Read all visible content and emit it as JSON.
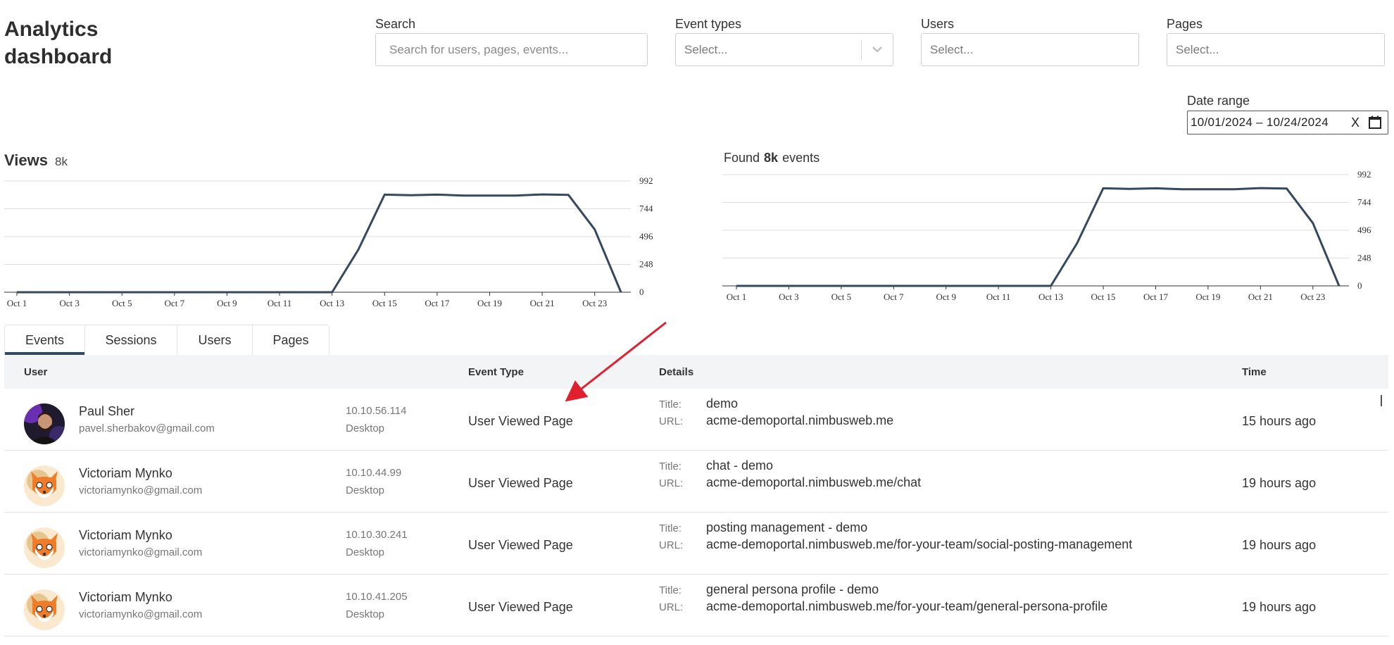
{
  "page": {
    "title_line1": "Analytics",
    "title_line2": "dashboard"
  },
  "filters": {
    "search": {
      "label": "Search",
      "placeholder": "Search for users, pages, events..."
    },
    "event_types": {
      "label": "Event types",
      "placeholder": "Select..."
    },
    "users": {
      "label": "Users",
      "placeholder": "Select..."
    },
    "pages": {
      "label": "Pages",
      "placeholder": "Select..."
    },
    "date_range": {
      "label": "Date range",
      "value": "10/01/2024 – 10/24/2024",
      "clear": "X"
    }
  },
  "views_chart": {
    "title": "Views",
    "total": "8k"
  },
  "events_chart": {
    "prefix": "Found",
    "count": "8k",
    "suffix": "events"
  },
  "chart_data": [
    {
      "type": "line",
      "title": "Views",
      "x": [
        "Oct 1",
        "Oct 2",
        "Oct 3",
        "Oct 4",
        "Oct 5",
        "Oct 6",
        "Oct 7",
        "Oct 8",
        "Oct 9",
        "Oct 10",
        "Oct 11",
        "Oct 12",
        "Oct 13",
        "Oct 14",
        "Oct 15",
        "Oct 16",
        "Oct 17",
        "Oct 18",
        "Oct 19",
        "Oct 20",
        "Oct 21",
        "Oct 22",
        "Oct 23",
        "Oct 24"
      ],
      "x_ticks": [
        "Oct 1",
        "Oct 3",
        "Oct 5",
        "Oct 7",
        "Oct 9",
        "Oct 11",
        "Oct 13",
        "Oct 15",
        "Oct 17",
        "Oct 19",
        "Oct 21",
        "Oct 23"
      ],
      "values": [
        0,
        0,
        0,
        0,
        0,
        0,
        0,
        0,
        0,
        0,
        0,
        0,
        0,
        380,
        870,
        865,
        870,
        862,
        862,
        862,
        872,
        868,
        560,
        0
      ],
      "y_ticks": [
        0,
        248,
        496,
        744,
        992
      ],
      "ylim": [
        0,
        992
      ],
      "grid": true,
      "color": "#34495e"
    },
    {
      "type": "line",
      "title": "",
      "x": [
        "Oct 1",
        "Oct 2",
        "Oct 3",
        "Oct 4",
        "Oct 5",
        "Oct 6",
        "Oct 7",
        "Oct 8",
        "Oct 9",
        "Oct 10",
        "Oct 11",
        "Oct 12",
        "Oct 13",
        "Oct 14",
        "Oct 15",
        "Oct 16",
        "Oct 17",
        "Oct 18",
        "Oct 19",
        "Oct 20",
        "Oct 21",
        "Oct 22",
        "Oct 23",
        "Oct 24"
      ],
      "x_ticks": [
        "Oct 1",
        "Oct 3",
        "Oct 5",
        "Oct 7",
        "Oct 9",
        "Oct 11",
        "Oct 13",
        "Oct 15",
        "Oct 17",
        "Oct 19",
        "Oct 21",
        "Oct 23"
      ],
      "values": [
        0,
        0,
        0,
        0,
        0,
        0,
        0,
        0,
        0,
        0,
        0,
        0,
        0,
        380,
        870,
        865,
        870,
        862,
        862,
        862,
        872,
        868,
        560,
        0
      ],
      "y_ticks": [
        0,
        248,
        496,
        744,
        992
      ],
      "ylim": [
        0,
        992
      ],
      "grid": true,
      "color": "#34495e"
    }
  ],
  "tabs": [
    {
      "label": "Events",
      "active": true
    },
    {
      "label": "Sessions",
      "active": false
    },
    {
      "label": "Users",
      "active": false
    },
    {
      "label": "Pages",
      "active": false
    }
  ],
  "table": {
    "headers": {
      "user": "User",
      "event_type": "Event Type",
      "details": "Details",
      "time": "Time"
    },
    "title_label": "Title:",
    "url_label": "URL:",
    "rows": [
      {
        "name": "Paul Sher",
        "email": "pavel.sherbakov@gmail.com",
        "ip": "10.10.56.114",
        "device": "Desktop",
        "event": "User Viewed Page",
        "title": "demo",
        "url": "acme-demoportal.nimbusweb.me",
        "time": "15 hours ago",
        "avatar": "photo"
      },
      {
        "name": "Victoriam Mynko",
        "email": "victoriamynko@gmail.com",
        "ip": "10.10.44.99",
        "device": "Desktop",
        "event": "User Viewed Page",
        "title": "chat - demo",
        "url": "acme-demoportal.nimbusweb.me/chat",
        "time": "19 hours ago",
        "avatar": "fox-icon"
      },
      {
        "name": "Victoriam Mynko",
        "email": "victoriamynko@gmail.com",
        "ip": "10.10.30.241",
        "device": "Desktop",
        "event": "User Viewed Page",
        "title": "posting management - demo",
        "url": "acme-demoportal.nimbusweb.me/for-your-team/social-posting-management",
        "time": "19 hours ago",
        "avatar": "fox-icon"
      },
      {
        "name": "Victoriam Mynko",
        "email": "victoriamynko@gmail.com",
        "ip": "10.10.41.205",
        "device": "Desktop",
        "event": "User Viewed Page",
        "title": "general persona profile - demo",
        "url": "acme-demoportal.nimbusweb.me/for-your-team/general-persona-profile",
        "time": "19 hours ago",
        "avatar": "fox-icon"
      }
    ]
  },
  "annotation": {
    "arrow_color": "#e0202e"
  }
}
